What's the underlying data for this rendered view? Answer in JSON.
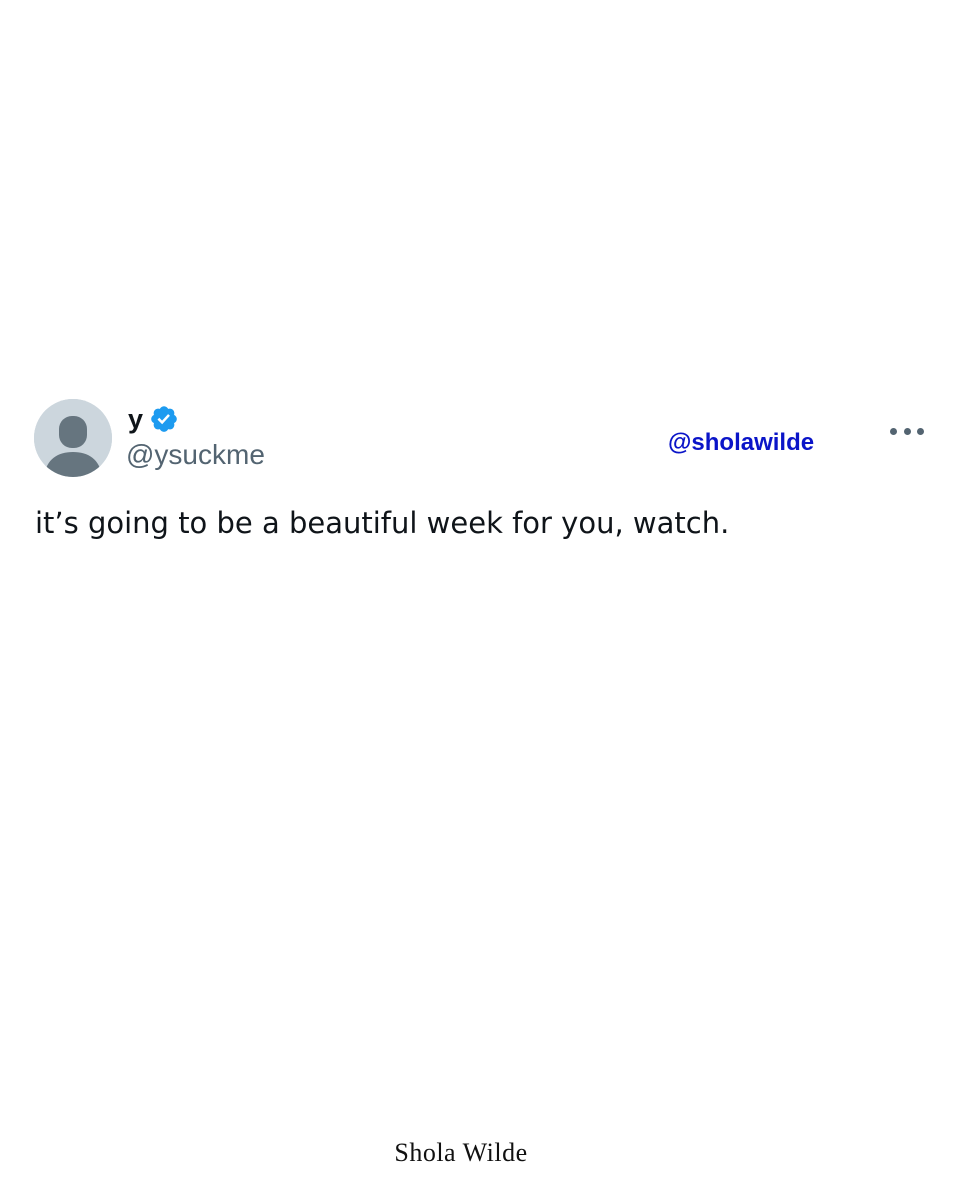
{
  "tweet": {
    "display_name": "y",
    "handle": "@ysuckme",
    "text": "it’s going to be a beautiful week for you, watch.",
    "verified_icon": "verified-badge-icon",
    "more_icon": "more-options-icon",
    "avatar_icon": "default-avatar-icon"
  },
  "watermark": {
    "handle": "@sholawilde",
    "color": "#0a14c8"
  },
  "signature": "Shola Wilde",
  "colors": {
    "verified": "#1d9bf0",
    "handle_gray": "#536471",
    "text": "#0f1419",
    "avatar_bg": "#ccd6dd",
    "avatar_fg": "#66757f"
  }
}
